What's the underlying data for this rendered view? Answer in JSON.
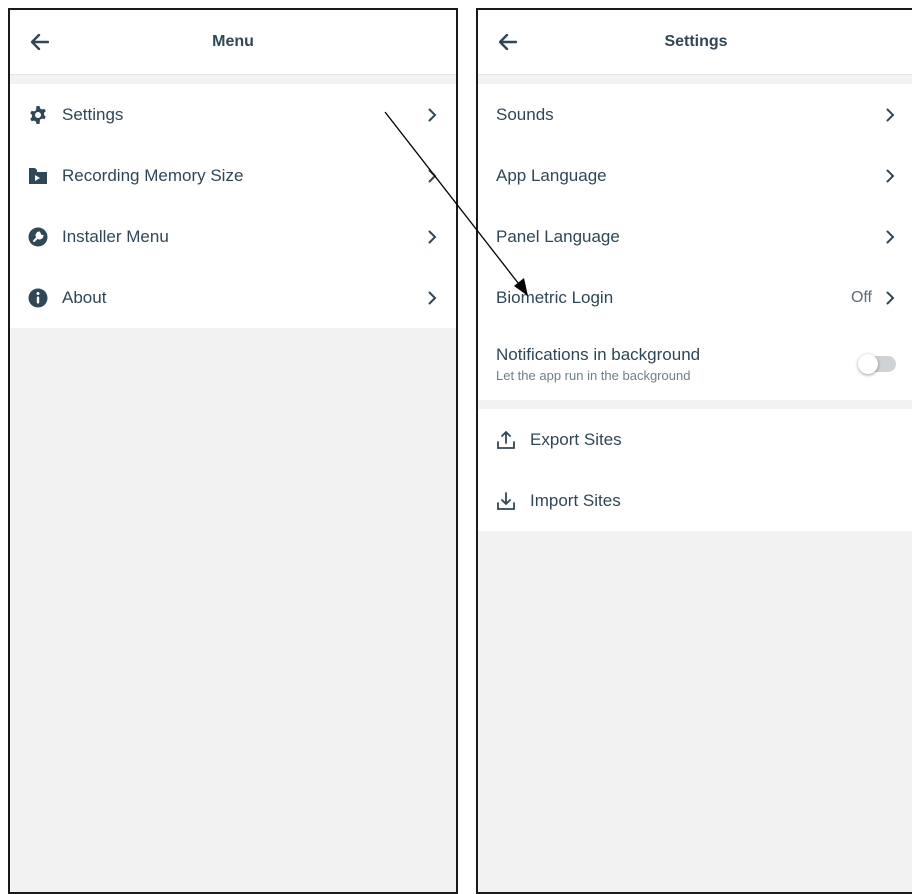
{
  "left_screen": {
    "title": "Menu",
    "items": [
      {
        "label": "Settings",
        "icon": "gear-icon"
      },
      {
        "label": "Recording Memory Size",
        "icon": "folder-play-icon"
      },
      {
        "label": "Installer Menu",
        "icon": "wrench-icon"
      },
      {
        "label": "About",
        "icon": "info-icon"
      }
    ]
  },
  "right_screen": {
    "title": "Settings",
    "items": [
      {
        "label": "Sounds"
      },
      {
        "label": "App Language"
      },
      {
        "label": "Panel Language"
      },
      {
        "label": "Biometric Login",
        "value": "Off"
      }
    ],
    "notifications": {
      "label": "Notifications in background",
      "sublabel": "Let the app run in the background",
      "toggle_on": false
    },
    "actions": [
      {
        "label": "Export Sites",
        "icon": "upload-icon"
      },
      {
        "label": "Import Sites",
        "icon": "download-icon"
      }
    ]
  },
  "colors": {
    "text": "#2f4756",
    "background": "#f2f2f2",
    "card": "#ffffff"
  }
}
